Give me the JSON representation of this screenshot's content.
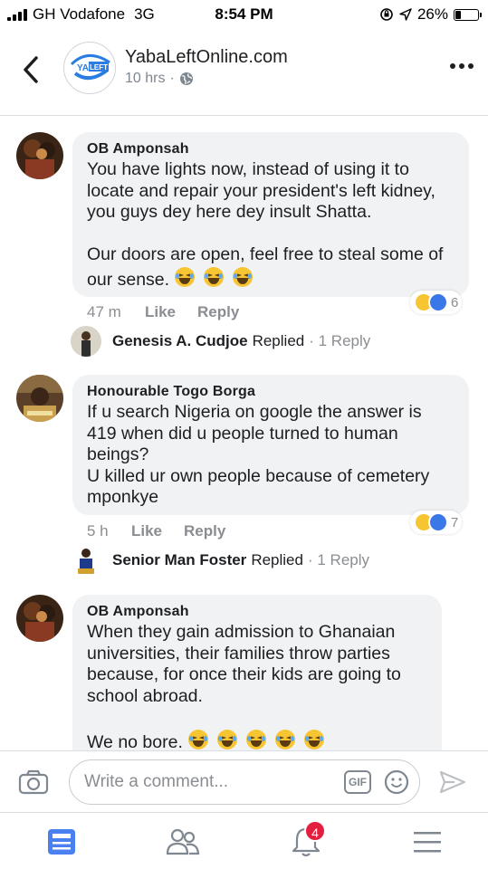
{
  "status_bar": {
    "carrier": "GH Vodafone",
    "network": "3G",
    "time": "8:54 PM",
    "battery_percent": "26%",
    "battery_level": 0.26
  },
  "header": {
    "page_name": "YabaLeftOnline.com",
    "post_age": "10 hrs",
    "logo_text": "LEFT"
  },
  "comments": [
    {
      "author": "OB Amponsah",
      "text": "You have lights now, instead of using it to locate and repair your president's left kidney, you guys dey here dey insult Shatta.\n\nOur doors are open, feel free to steal some of our sense.",
      "laugh_emojis": 3,
      "time": "47 m",
      "like_label": "Like",
      "reply_label": "Reply",
      "reaction_count": "6",
      "reply_preview": {
        "name": "Genesis A. Cudjoe",
        "verb": "Replied",
        "count": "1 Reply"
      }
    },
    {
      "author": "Honourable Togo Borga",
      "text": "If u search Nigeria on google the answer is 419 when did u people turned to human beings?\nU killed ur own people because of cemetery mponkye",
      "laugh_emojis": 0,
      "time": "5 h",
      "like_label": "Like",
      "reply_label": "Reply",
      "reaction_count": "7",
      "reply_preview": {
        "name": "Senior Man Foster",
        "verb": "Replied",
        "count": "1 Reply"
      }
    },
    {
      "author": "OB Amponsah",
      "text": "When they gain admission to Ghanaian universities, their families throw parties because, for once their kids are going to school abroad.\n\nWe no bore.",
      "laugh_emojis": 5
    }
  ],
  "composer": {
    "placeholder": "Write a comment...",
    "gif_label": "GIF"
  },
  "tabbar": {
    "notifications_badge": "4"
  },
  "colors": {
    "bubble": "#f1f2f4",
    "like_blue": "#3b78e7",
    "haha_yellow": "#f7c531",
    "badge_red": "#e41e3f",
    "muted": "#8a8d91"
  }
}
